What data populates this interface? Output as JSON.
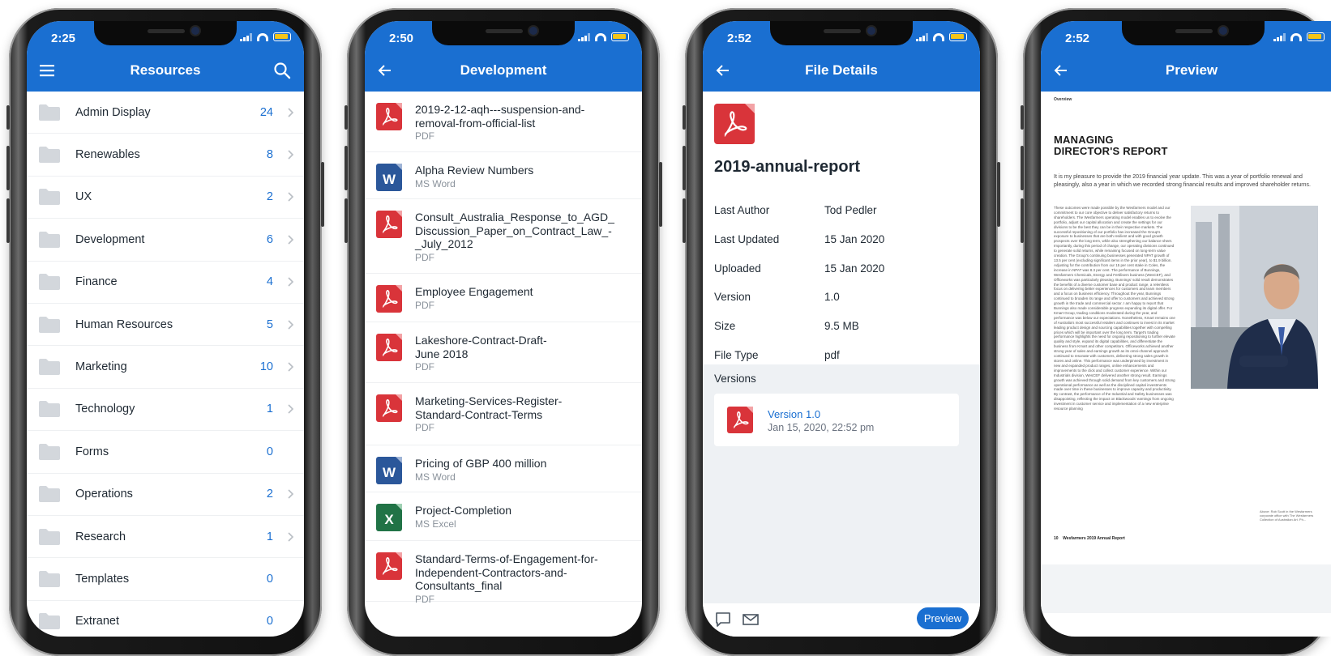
{
  "colors": {
    "brand_blue": "#1a6fd1",
    "pdf_red": "#d9343a",
    "word_blue": "#2b579a",
    "excel_green": "#217346"
  },
  "screen1": {
    "time": "2:25",
    "title": "Resources",
    "folders": [
      {
        "label": "Admin Display",
        "count": "24",
        "has_chevron": true
      },
      {
        "label": "Renewables",
        "count": "8",
        "has_chevron": true
      },
      {
        "label": "UX",
        "count": "2",
        "has_chevron": true
      },
      {
        "label": "Development",
        "count": "6",
        "has_chevron": true
      },
      {
        "label": "Finance",
        "count": "4",
        "has_chevron": true
      },
      {
        "label": "Human Resources",
        "count": "5",
        "has_chevron": true
      },
      {
        "label": "Marketing",
        "count": "10",
        "has_chevron": true
      },
      {
        "label": "Technology",
        "count": "1",
        "has_chevron": true
      },
      {
        "label": "Forms",
        "count": "0",
        "has_chevron": false
      },
      {
        "label": "Operations",
        "count": "2",
        "has_chevron": true
      },
      {
        "label": "Research",
        "count": "1",
        "has_chevron": true
      },
      {
        "label": "Templates",
        "count": "0",
        "has_chevron": false
      },
      {
        "label": "Extranet",
        "count": "0",
        "has_chevron": false
      }
    ]
  },
  "screen2": {
    "time": "2:50",
    "title": "Development",
    "files": [
      {
        "name": "2019-2-12-aqh---suspension-and-removal-from-official-list",
        "lines": [
          "2019-2-12-aqh---suspension-and-",
          "removal-from-official-list"
        ],
        "type": "PDF",
        "icon": "pdf-icon"
      },
      {
        "name": "Alpha Review Numbers",
        "lines": [
          "Alpha Review Numbers"
        ],
        "type": "MS Word",
        "icon": "word-icon"
      },
      {
        "name": "Consult_Australia_Response_to_AGD_Discussion_Paper_on_Contract_Law_-_July_2012",
        "lines": [
          "Consult_Australia_Response_to_AGD_",
          "Discussion_Paper_on_Contract_Law_-",
          "_July_2012"
        ],
        "type": "PDF",
        "icon": "pdf-icon"
      },
      {
        "name": "Employee Engagement",
        "lines": [
          "Employee Engagement"
        ],
        "type": "PDF",
        "icon": "pdf-icon"
      },
      {
        "name": "Lakeshore-Contract-Draft-June 2018",
        "lines": [
          "Lakeshore-Contract-Draft-",
          "June 2018"
        ],
        "type": "PDF",
        "icon": "pdf-icon"
      },
      {
        "name": "Marketing-Services-Register-Standard-Contract-Terms",
        "lines": [
          "Marketing-Services-Register-",
          "Standard-Contract-Terms"
        ],
        "type": "PDF",
        "icon": "pdf-icon"
      },
      {
        "name": "Pricing of GBP 400 million",
        "lines": [
          "Pricing of GBP 400 million"
        ],
        "type": "MS Word",
        "icon": "word-icon"
      },
      {
        "name": "Project-Completion",
        "lines": [
          "Project-Completion"
        ],
        "type": "MS Excel",
        "icon": "excel-icon"
      },
      {
        "name": "Standard-Terms-of-Engagement-for-Independent-Contractors-and-Consultants_final",
        "lines": [
          "Standard-Terms-of-Engagement-for-",
          "Independent-Contractors-and-",
          "Consultants_final"
        ],
        "type": "PDF",
        "icon": "pdf-icon"
      }
    ]
  },
  "screen3": {
    "time": "2:52",
    "title": "File Details",
    "file_name": "2019-annual-report",
    "properties": [
      {
        "label": "Last Author",
        "value": "Tod Pedler"
      },
      {
        "label": "Last Updated",
        "value": "15 Jan 2020"
      },
      {
        "label": "Uploaded",
        "value": "15 Jan 2020"
      },
      {
        "label": "Version",
        "value": "1.0"
      },
      {
        "label": "Size",
        "value": "9.5 MB"
      },
      {
        "label": "File Type",
        "value": "pdf"
      }
    ],
    "versions_label": "Versions",
    "version": {
      "title": "Version 1.0",
      "date": "Jan 15, 2020, 22:52 pm"
    },
    "preview_button": "Preview"
  },
  "screen4": {
    "time": "2:52",
    "title": "Preview",
    "doc": {
      "overview": "Overview",
      "heading_line1": "MANAGING",
      "heading_line2": "DIRECTOR'S REPORT",
      "intro": "It is my pleasure to provide the 2019 financial year update. This was a year of portfolio renewal and pleasingly, also a year in which we recorded strong financial results and improved shareholder returns.",
      "body": "These outcomes were made possible by the Wesfarmers model and our commitment to our core objective to deliver satisfactory returns to shareholders. The Wesfarmers operating model enables us to evolve the portfolio, adjust our capital allocation and create the settings for our divisions to be the best they can be in their respective markets. The successful repositioning of our portfolio has increased the Group's exposure to businesses that are both resilient and with good growth prospects over the long term, while also strengthening our balance sheet. Importantly, during this period of change, our operating divisions continued to generate solid returns, while remaining focused on long-term value creation. The Group's continuing businesses generated NPAT growth of 13.5 per cent (excluding significant items in the prior year), to $1.9 billion. Adjusting for the contribution from our 15 per cent stake in Coles, the increase in NPAT was 8.3 per cent. The performance of Bunnings, Wesfarmers Chemicals, Energy and Fertilisers business (WesCEF), and Officeworks was particularly pleasing. Bunnings' solid result demonstrates the benefits of a diverse customer base and product range, a relentless focus on delivering better experiences for customers and team members and a focus on business efficiency. Throughout the year, Bunnings continued to broaden its range and offer to customers and achieved strong growth in the trade and commercial sector. I am happy to report that Bunnings also made considerable progress expanding its digital offer. For Kmart Group, trading conditions moderated during the year, and performance was below our expectations. Nonetheless, Kmart remains one of Australia's most successful retailers and continues to invest in its market leading product design and sourcing capabilities together with compelling prices which will be important over the long term. Target's trading performance highlights the need for ongoing repositioning to further elevate quality and style, expand its digital capabilities, and differentiate the business from Kmart and other competitors. Officeworks achieved another strong year of sales and earnings growth as its omni-channel approach continued to resonate with customers, delivering strong sales growth in stores and online. This performance was underpinned by investment in new and expanded product ranges, online enhancements and improvements to the click and collect customer experience. Within our Industrials division, WesCEF delivered another strong result. Earnings growth was achieved through solid demand from key customers and strong operational performance as well as the disciplined capital investments made over time in these businesses to improve capacity and productivity. By contrast, the performance of the Industrial and Safety businesses was disappointing, reflecting the impact on Blackwoods' earnings from ongoing investment in customer service and implementation of a new enterprise resource planning",
      "caption": "Above: Rob Scott in the Wesfarmers corporate office with The Wesfarmers Collection of Australian Art. Ph...",
      "footer": "10    Wesfarmers 2019 Annual Report"
    }
  }
}
